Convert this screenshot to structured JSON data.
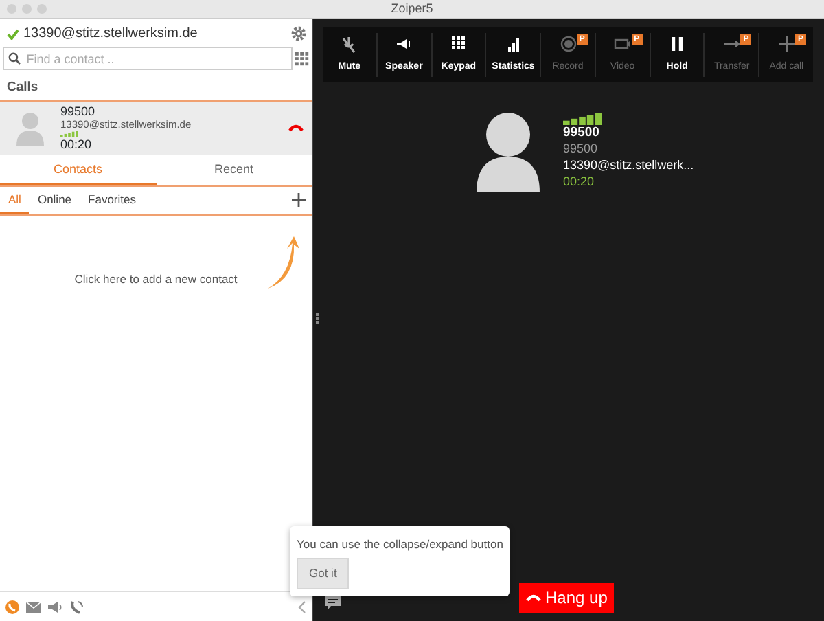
{
  "window": {
    "title": "Zoiper5"
  },
  "account": {
    "name": "13390@stitz.stellwerksim.de",
    "online": true
  },
  "search": {
    "placeholder": "Find a contact .."
  },
  "calls": {
    "heading": "Calls",
    "items": [
      {
        "number": "99500",
        "account": "13390@stitz.stellwerksim.de",
        "duration": "00:20",
        "selected": true
      }
    ]
  },
  "tabs": [
    {
      "label": "Contacts",
      "selected": true
    },
    {
      "label": "Recent",
      "selected": false
    }
  ],
  "filters": [
    {
      "label": "All",
      "selected": true
    },
    {
      "label": "Online",
      "selected": false
    },
    {
      "label": "Favorites",
      "selected": false
    }
  ],
  "empty_hint": "Click here to add a new contact",
  "toolbar": [
    {
      "label": "Mute",
      "kind": "mute",
      "disabled": false
    },
    {
      "label": "Speaker",
      "kind": "speaker",
      "disabled": false
    },
    {
      "label": "Keypad",
      "kind": "keypad",
      "disabled": false
    },
    {
      "label": "Statistics",
      "kind": "stats",
      "disabled": false
    },
    {
      "label": "Record",
      "kind": "record",
      "disabled": true,
      "badge": "P"
    },
    {
      "label": "Video",
      "kind": "video",
      "disabled": true,
      "badge": "P"
    },
    {
      "label": "Hold",
      "kind": "hold",
      "disabled": false
    },
    {
      "label": "Transfer",
      "kind": "transfer",
      "disabled": true,
      "badge": "P"
    },
    {
      "label": "Add call",
      "kind": "add",
      "disabled": true,
      "badge": "P"
    }
  ],
  "active_call": {
    "name": "99500",
    "number": "99500",
    "account": "13390@stitz.stellwerk...",
    "duration": "00:20"
  },
  "tooltip": {
    "text": "You can use the collapse/expand button",
    "button": "Got it"
  },
  "hangup": {
    "label": "Hang up"
  }
}
